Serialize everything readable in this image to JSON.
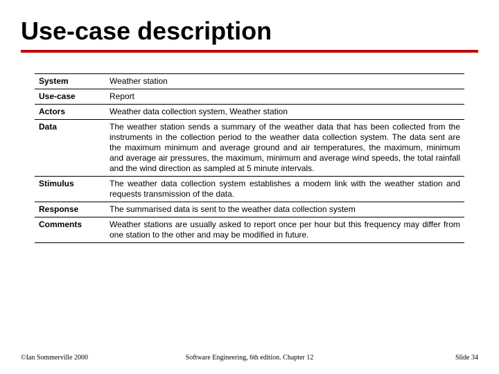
{
  "title": "Use-case description",
  "rows": [
    {
      "label": "System",
      "value": "Weather station"
    },
    {
      "label": "Use-case",
      "value": "Report"
    },
    {
      "label": "Actors",
      "value": "Weather data collection system, Weather station"
    },
    {
      "label": "Data",
      "value": "The weather station sends a summary of the weather data that has been collected from the instruments in the collection period to the weather data collection system. The data sent are the maximum minimum and average ground and air temperatures, the maximum, minimum and average air pressures, the maximum, minimum and average wind speeds, the total rainfall and the wind direction as sampled at 5 minute intervals."
    },
    {
      "label": "Stimulus",
      "value": "The weather data collection system establishes a modem link with the weather station and requests transmission of the data."
    },
    {
      "label": "Response",
      "value": "The summarised data is sent to the weather data collection system"
    },
    {
      "label": "Comments",
      "value": "Weather stations are usually asked to report once per hour but this frequency may differ from one station to the other and may be modified in future."
    }
  ],
  "footer": {
    "left": "©Ian Sommerville 2000",
    "center": "Software Engineering, 6th edition. Chapter 12",
    "right": "Slide 34"
  }
}
